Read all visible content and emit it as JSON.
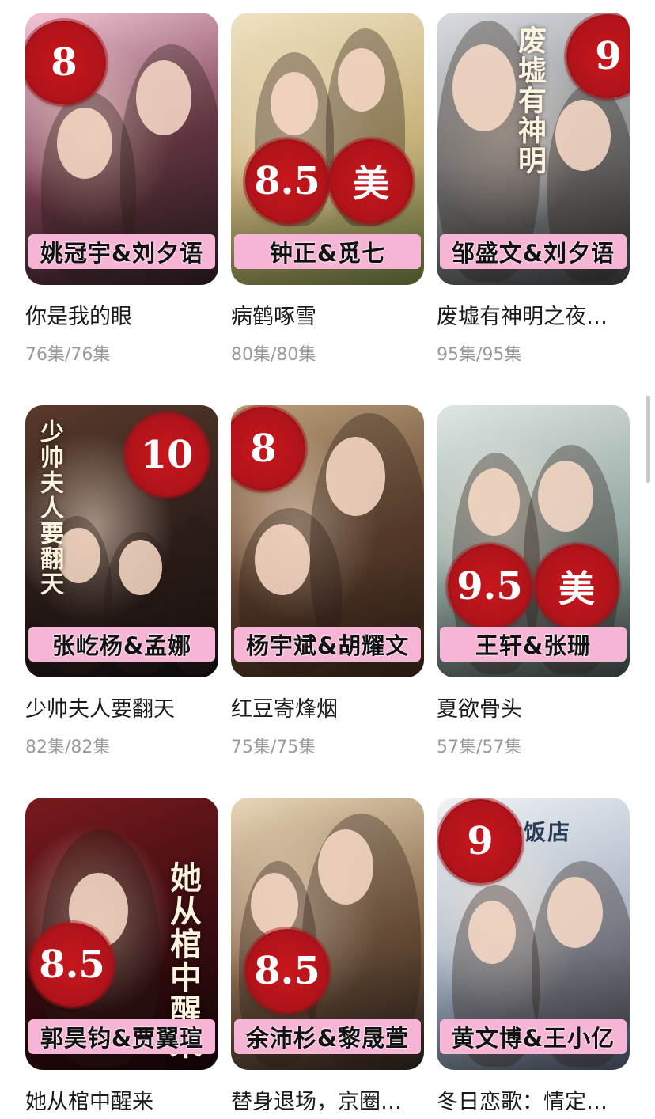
{
  "shows": [
    {
      "name": "你是我的眼",
      "episodes": "76集/76集",
      "cast": "姚冠宇&刘夕语",
      "score": "8",
      "mei": "",
      "poster_title": "",
      "colors": {
        "a": "#f3c6d6",
        "b": "#7a3f52",
        "c": "#2b1d24"
      }
    },
    {
      "name": "病鹤啄雪",
      "episodes": "80集/80集",
      "cast": "钟正&觅七",
      "score": "8.5",
      "mei": "美",
      "poster_title": "",
      "colors": {
        "a": "#efe2c3",
        "b": "#c9b27c",
        "c": "#6b7a3c"
      }
    },
    {
      "name": "废墟有神明之夜…",
      "episodes": "95集/95集",
      "cast": "邹盛文&刘夕语",
      "score": "9",
      "mei": "",
      "poster_title": "废墟有神明",
      "colors": {
        "a": "#d9dde0",
        "b": "#8c8f92",
        "c": "#3a3c40"
      }
    },
    {
      "name": "少帅夫人要翻天",
      "episodes": "82集/82集",
      "cast": "张屹杨&孟娜",
      "score": "10",
      "mei": "",
      "poster_title": "少帅夫人要翻天",
      "colors": {
        "a": "#5a3a2c",
        "b": "#2c1e1a",
        "c": "#151014"
      }
    },
    {
      "name": "红豆寄烽烟",
      "episodes": "75集/75集",
      "cast": "杨宇斌&胡耀文",
      "score": "8",
      "mei": "",
      "poster_title": "",
      "colors": {
        "a": "#b9a07c",
        "b": "#6b4a34",
        "c": "#3a2418"
      }
    },
    {
      "name": "夏欲骨头",
      "episodes": "57集/57集",
      "cast": "王轩&张珊",
      "score": "9.5",
      "mei": "美",
      "poster_title": "",
      "colors": {
        "a": "#dfe6e4",
        "b": "#95a8a2",
        "c": "#3f4c49"
      }
    },
    {
      "name": "她从棺中醒来",
      "episodes": "",
      "cast": "郭昊钧&贾翼瑄",
      "score": "8.5",
      "mei": "",
      "poster_title": "她从棺中醒来",
      "colors": {
        "a": "#7a1a1e",
        "b": "#3a0c10",
        "c": "#1a0608"
      }
    },
    {
      "name": "替身退场，京圈…",
      "episodes": "",
      "cast": "余沛杉&黎晟萱",
      "score": "8.5",
      "mei": "",
      "poster_title": "",
      "colors": {
        "a": "#e9d6b8",
        "b": "#8a6a4c",
        "c": "#2c221c"
      }
    },
    {
      "name": "冬日恋歌：情定…",
      "episodes": "",
      "cast": "黄文博&王小亿",
      "score": "9",
      "mei": "",
      "poster_title": "大饭店",
      "colors": {
        "a": "#f1f3f6",
        "b": "#a8b4c4",
        "c": "#4a5668"
      }
    }
  ]
}
